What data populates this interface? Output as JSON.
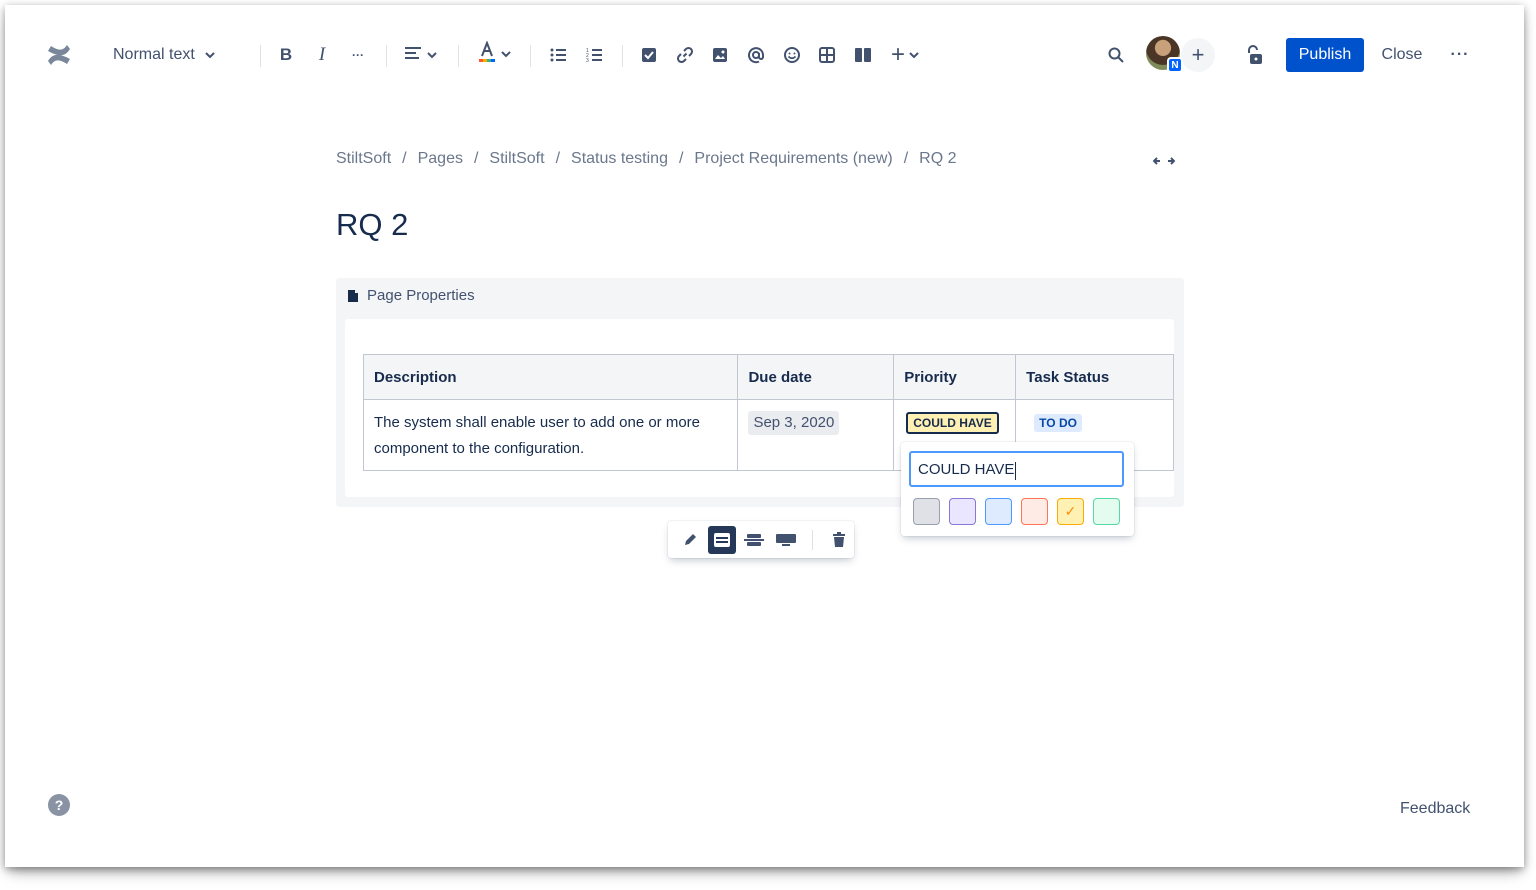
{
  "toolbar": {
    "text_style": "Normal text",
    "bold": "B",
    "italic": "I",
    "more": "···",
    "insert_plus": "+",
    "publish": "Publish",
    "close": "Close",
    "overflow": "···",
    "avatar_badge": "N",
    "invite": "+"
  },
  "breadcrumb": {
    "items": [
      "StiltSoft",
      "Pages",
      "StiltSoft",
      "Status testing",
      "Project Requirements (new)",
      "RQ 2"
    ],
    "separator": "/"
  },
  "page": {
    "title": "RQ 2"
  },
  "macro": {
    "title": "Page Properties",
    "table": {
      "headers": [
        "Description",
        "Due date",
        "Priority",
        "Task Status"
      ],
      "row": {
        "description": "The system shall enable user to add one or more component to the configuration.",
        "due_date": "Sep 3, 2020",
        "priority": "COULD HAVE",
        "task_status": "TO DO"
      }
    }
  },
  "status_popup": {
    "input_value": "COULD HAVE",
    "swatches": [
      {
        "name": "neutral",
        "bg": "#DFE1E6",
        "border": "#97A0AF"
      },
      {
        "name": "purple",
        "bg": "#EAE6FF",
        "border": "#8777D9"
      },
      {
        "name": "blue",
        "bg": "#DEEBFF",
        "border": "#4C9AFF"
      },
      {
        "name": "red",
        "bg": "#FFEBE6",
        "border": "#FF7452"
      },
      {
        "name": "yellow",
        "bg": "#FFF0B3",
        "border": "#FFAB00",
        "selected": true
      },
      {
        "name": "green",
        "bg": "#E3FCEF",
        "border": "#57D9A3"
      }
    ],
    "check": "✓"
  },
  "footer": {
    "help": "?",
    "feedback": "Feedback"
  },
  "colors": {
    "primary": "#0052CC",
    "text": "#172B4D",
    "subtle": "#42526E"
  }
}
